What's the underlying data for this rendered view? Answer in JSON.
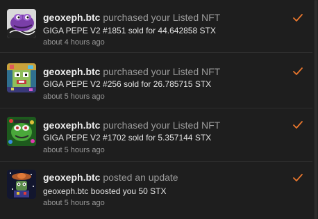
{
  "notifications": [
    {
      "user": "geoxeph.btc",
      "action": "purchased your Listed NFT",
      "detail": "GIGA PEPE V2 #1851 sold for 44.642858 STX",
      "time": "about 4 hours ago",
      "avatar_icon": "purple-pepe-avatar",
      "status_icon": "check-icon"
    },
    {
      "user": "geoxeph.btc",
      "action": "purchased your Listed NFT",
      "detail": "GIGA PEPE V2 #256 sold for 26.785715 STX",
      "time": "about 5 hours ago",
      "avatar_icon": "pixel-pepe-avatar",
      "status_icon": "check-icon"
    },
    {
      "user": "geoxeph.btc",
      "action": "purchased your Listed NFT",
      "detail": "GIGA PEPE V2 #1702 sold for 5.357144 STX",
      "time": "about 5 hours ago",
      "avatar_icon": "green-pepe-avatar",
      "status_icon": "check-icon"
    },
    {
      "user": "geoxeph.btc",
      "action": "posted an update",
      "detail": "geoxeph.btc boosted you 50 STX",
      "time": "about 5 hours ago",
      "avatar_icon": "space-pepe-avatar",
      "status_icon": "check-icon"
    }
  ],
  "colors": {
    "background": "#1e1e1e",
    "accent_check": "#e8762d",
    "username": "#eeeeee",
    "muted": "#9a9a9a"
  }
}
